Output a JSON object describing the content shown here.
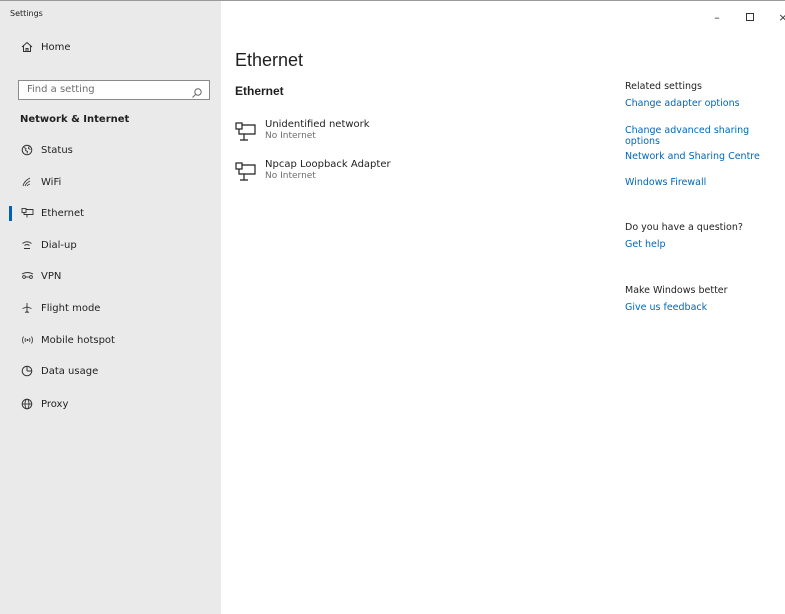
{
  "window": {
    "title": "Settings",
    "controls": {
      "minimize": "–",
      "close": "×"
    }
  },
  "sidebar": {
    "home_label": "Home",
    "search_placeholder": "Find a setting",
    "section_header": "Network & Internet",
    "items": [
      {
        "label": "Status",
        "icon": "globe-icon"
      },
      {
        "label": "WiFi",
        "icon": "wifi-icon"
      },
      {
        "label": "Ethernet",
        "icon": "ethernet-icon",
        "active": true
      },
      {
        "label": "Dial-up",
        "icon": "dial-up-icon"
      },
      {
        "label": "VPN",
        "icon": "vpn-icon"
      },
      {
        "label": "Flight mode",
        "icon": "airplane-icon"
      },
      {
        "label": "Mobile hotspot",
        "icon": "hotspot-icon"
      },
      {
        "label": "Data usage",
        "icon": "data-usage-icon"
      },
      {
        "label": "Proxy",
        "icon": "proxy-globe-icon"
      }
    ]
  },
  "main": {
    "page_title": "Ethernet",
    "section_title": "Ethernet",
    "networks": [
      {
        "name": "Unidentified network",
        "status": "No Internet"
      },
      {
        "name": "Npcap Loopback Adapter",
        "status": "No Internet"
      }
    ]
  },
  "related": {
    "heading": "Related settings",
    "links": [
      "Change adapter options",
      "Change advanced sharing options",
      "Network and Sharing Centre",
      "Windows Firewall"
    ],
    "question_heading": "Do you have a question?",
    "help_link": "Get help",
    "better_heading": "Make Windows better",
    "feedback_link": "Give us feedback"
  },
  "colors": {
    "accent": "#0063b1",
    "link": "#0067b8",
    "sidebar_bg": "#eaeaea"
  }
}
